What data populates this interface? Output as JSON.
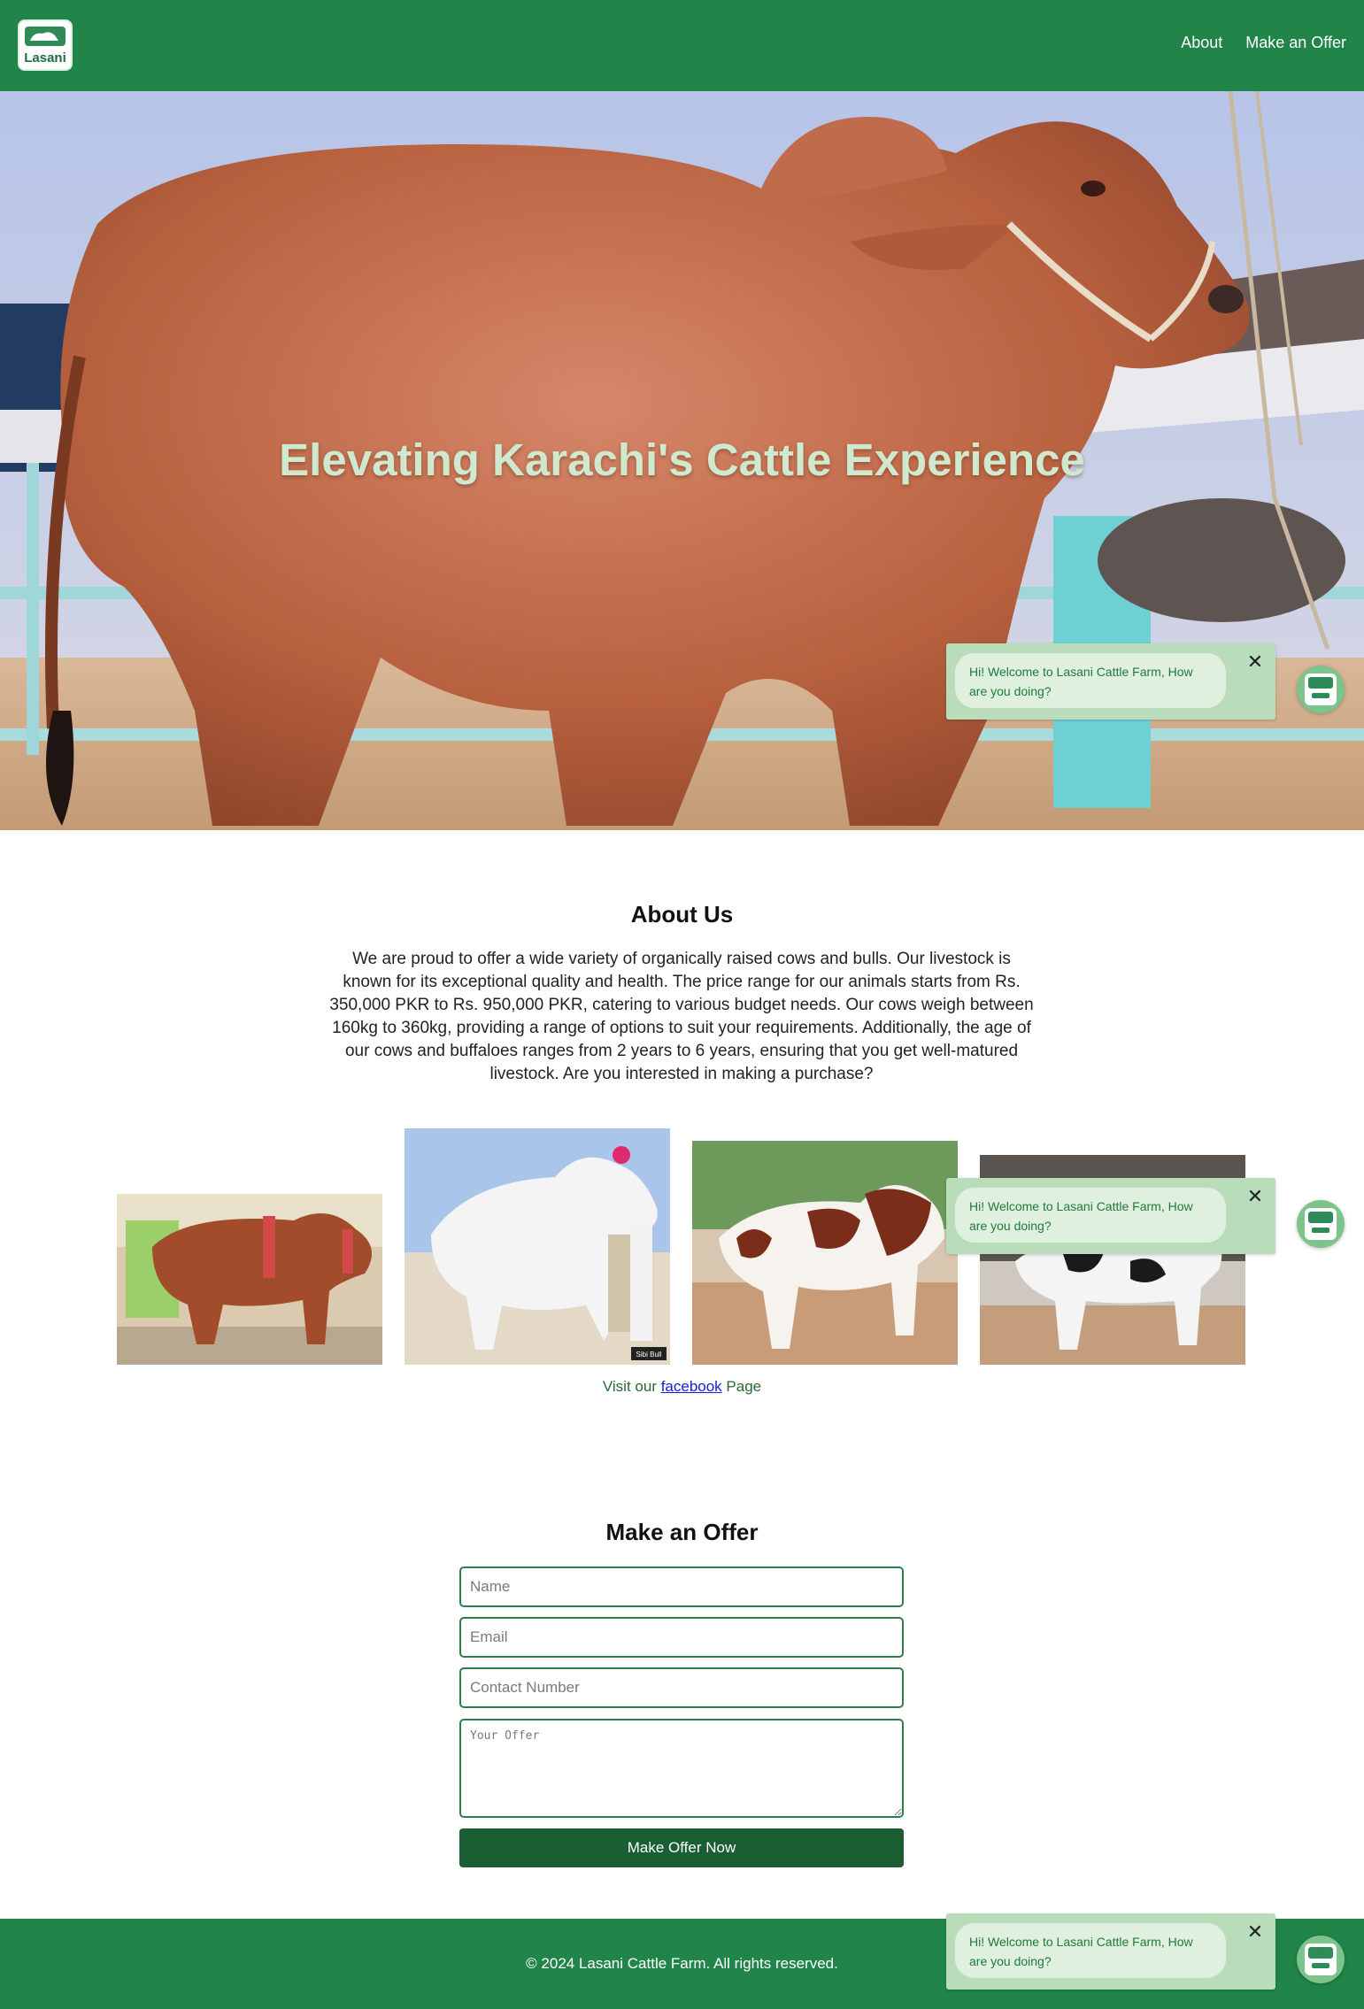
{
  "header": {
    "logo_text": "Lasani",
    "nav": [
      {
        "label": "About"
      },
      {
        "label": "Make an Offer"
      }
    ]
  },
  "hero": {
    "title": "Elevating Karachi's Cattle Experience"
  },
  "about": {
    "title": "About Us",
    "text": "We are proud to offer a wide variety of organically raised cows and bulls. Our livestock is known for its exceptional quality and health. The price range for our animals starts from Rs. 350,000 PKR to Rs. 950,000 PKR, catering to various budget needs. Our cows weigh between 160kg to 360kg, providing a range of options to suit your requirements. Additionally, the age of our cows and buffaloes ranges from 2 years to 6 years, ensuring that you get well-matured livestock. Are you interested in making a purchase?",
    "gallery_caption": "Sibi Bull",
    "facebook_prefix": "Visit our ",
    "facebook_link": "facebook",
    "facebook_suffix": " Page"
  },
  "offer": {
    "title": "Make an Offer",
    "name_placeholder": "Name",
    "email_placeholder": "Email",
    "contact_placeholder": "Contact Number",
    "offer_placeholder": "Your Offer",
    "submit_label": "Make Offer Now"
  },
  "footer": {
    "text": "© 2024 Lasani Cattle Farm. All rights reserved."
  },
  "chat": {
    "message": "Hi! Welcome to Lasani Cattle Farm, How are you doing?",
    "close": "✕"
  },
  "colors": {
    "brand_green": "#218549",
    "button_green": "#1b5e34",
    "chat_bg": "#b9dcba"
  }
}
